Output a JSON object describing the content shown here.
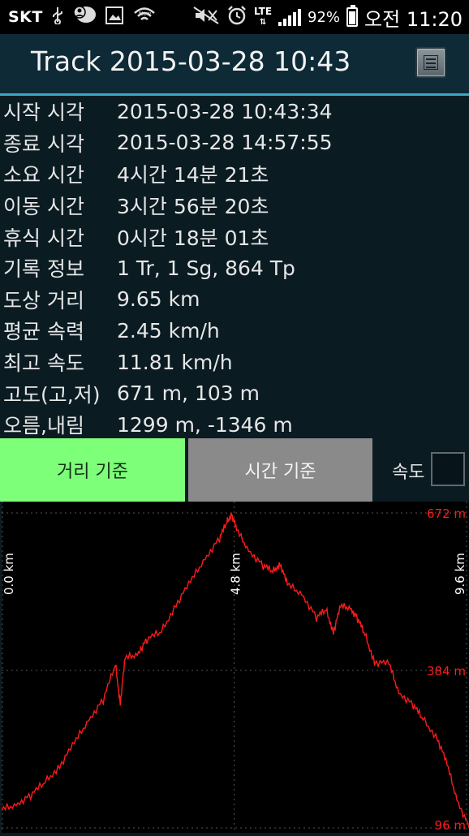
{
  "status_bar": {
    "carrier": "SKT",
    "icons": [
      "usb-icon",
      "chat-icon",
      "image-icon",
      "wifi-new-icon",
      "mute-icon",
      "alarm-icon"
    ],
    "network": "LTE",
    "battery_percent": "92%",
    "time": "오전 11:20"
  },
  "appbar": {
    "title": "Track 2015-03-28 10:43",
    "menu_icon": "menu-list-icon"
  },
  "info": [
    {
      "label": "시작 시각",
      "value": "2015-03-28 10:43:34"
    },
    {
      "label": "종료 시각",
      "value": "2015-03-28 14:57:55"
    },
    {
      "label": "소요 시간",
      "value": "4시간 14분 21초"
    },
    {
      "label": "이동 시간",
      "value": "3시간 56분 20초"
    },
    {
      "label": "휴식 시간",
      "value": "0시간 18분 01초"
    },
    {
      "label": "기록 정보",
      "value": "1 Tr, 1 Sg, 864 Tp"
    },
    {
      "label": "도상 거리",
      "value": "9.65 km"
    },
    {
      "label": "평균 속력",
      "value": "2.45 km/h"
    },
    {
      "label": "최고 속도",
      "value": "11.81 km/h"
    },
    {
      "label": "고도(고,저)",
      "value": "671 m, 103 m"
    },
    {
      "label": "오름,내림",
      "value": "1299 m, -1346 m"
    }
  ],
  "controls": {
    "distance_button": "거리 기준",
    "time_button": "시간 기준",
    "speed_label": "속도",
    "speed_checked": false,
    "active_mode": "distance"
  },
  "chart_data": {
    "type": "line",
    "x_tick_labels": [
      "0.0 km",
      "4.8 km",
      "9.6 km"
    ],
    "x_ticks": [
      0.0,
      4.8,
      9.6
    ],
    "y_tick_labels": [
      "672 m",
      "384 m",
      "96 m"
    ],
    "y_ticks": [
      672,
      384,
      96
    ],
    "xlim": [
      0.0,
      9.65
    ],
    "ylim": [
      96,
      672
    ],
    "grid": true,
    "line_color": "#ff1a1a",
    "grid_color": "#555555",
    "x": [
      0.0,
      0.3,
      0.6,
      0.9,
      1.2,
      1.5,
      1.8,
      2.1,
      2.35,
      2.45,
      2.55,
      2.8,
      3.0,
      3.3,
      3.6,
      3.9,
      4.2,
      4.5,
      4.65,
      4.75,
      4.85,
      5.1,
      5.4,
      5.6,
      5.75,
      5.9,
      6.2,
      6.5,
      6.7,
      6.85,
      7.0,
      7.2,
      7.35,
      7.5,
      7.7,
      8.0,
      8.2,
      8.5,
      8.7,
      9.0,
      9.2,
      9.4,
      9.65
    ],
    "y": [
      128,
      140,
      155,
      180,
      210,
      250,
      295,
      330,
      395,
      325,
      405,
      415,
      440,
      455,
      505,
      545,
      590,
      625,
      655,
      671,
      640,
      605,
      575,
      565,
      580,
      540,
      525,
      480,
      495,
      455,
      500,
      500,
      478,
      450,
      400,
      395,
      345,
      320,
      295,
      260,
      210,
      150,
      96
    ]
  },
  "colors": {
    "status_bar_bg": "#000000",
    "app_bg": "#0a1b22",
    "appbar_bg": "#0e2a36",
    "accent_line": "#36a9c9",
    "active_button": "#7dff7a",
    "inactive_button": "#8a8a8a"
  }
}
